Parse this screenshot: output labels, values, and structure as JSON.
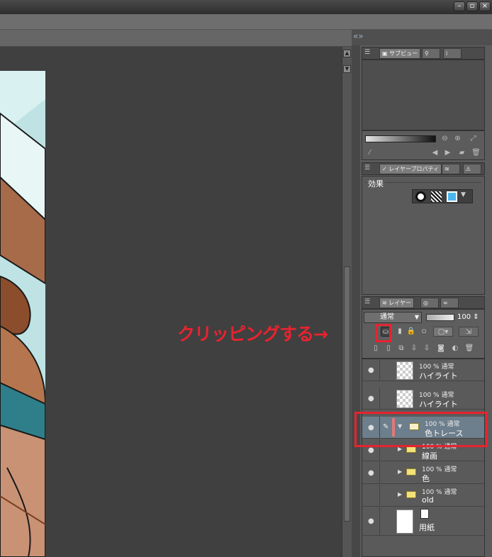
{
  "window": {
    "controls": [
      "minimize",
      "restore",
      "close"
    ],
    "symbols": [
      "–",
      "▫",
      "×"
    ]
  },
  "subview": {
    "tabs": [
      "サブビュー"
    ]
  },
  "layer_property": {
    "tab_label": "レイヤープロパティ",
    "effects_label": "効果"
  },
  "layer_panel": {
    "tab_label": "レイヤー",
    "blend_mode": "通常",
    "opacity": "100",
    "layers": [
      {
        "percent": "100 % 通常",
        "name": "ハイライト",
        "visible": true,
        "type": "raster"
      },
      {
        "percent": "100 % 通常",
        "name": "ハイライト",
        "visible": true,
        "type": "raster"
      },
      {
        "percent": "100 % 通常",
        "name": "色トレース",
        "visible": true,
        "type": "folder",
        "selected": true,
        "expanded": true
      },
      {
        "percent": "100 % 通常",
        "name": "線画",
        "visible": true,
        "type": "folder"
      },
      {
        "percent": "100 % 通常",
        "name": "色",
        "visible": true,
        "type": "folder"
      },
      {
        "percent": "100 % 通常",
        "name": "old",
        "visible": false,
        "type": "folder"
      },
      {
        "percent": "",
        "name": "用紙",
        "visible": true,
        "type": "paper"
      }
    ]
  },
  "annotation": {
    "text": "クリッピングする→",
    "color": "#e8232f"
  },
  "colors": {
    "canvas_bg": "#404040",
    "panel_bg": "#5c5c5c",
    "selected_row": "#6d7e8c",
    "highlight": "#e8232f"
  }
}
